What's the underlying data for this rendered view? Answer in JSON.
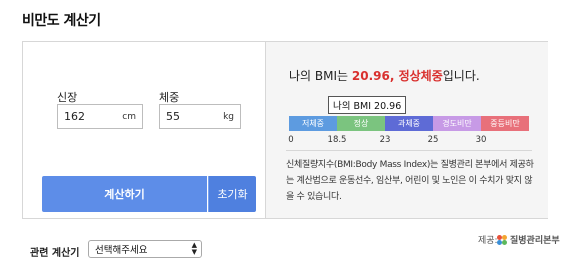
{
  "page": {
    "title": "비만도 계산기"
  },
  "inputs": {
    "height": {
      "label": "신장",
      "value": "162",
      "unit": "cm"
    },
    "weight": {
      "label": "체중",
      "value": "55",
      "unit": "kg"
    }
  },
  "buttons": {
    "calculate": "계산하기",
    "reset": "초기화"
  },
  "result": {
    "prefix": "나의 BMI는 ",
    "bmi": "20.96",
    "separator": ", ",
    "category": "정상체중",
    "suffix": "입니다.",
    "tooltip": "나의 BMI 20.96",
    "bmi_value": 20.96,
    "highlight_color": "#d9302e"
  },
  "scale": {
    "segments": [
      {
        "label": "저체중",
        "color": "#5d9be0"
      },
      {
        "label": "정상",
        "color": "#7bc47f"
      },
      {
        "label": "과체중",
        "color": "#5e6bd6"
      },
      {
        "label": "경도비만",
        "color": "#c79ae6"
      },
      {
        "label": "중등비만",
        "color": "#e8707a"
      }
    ],
    "ticks": [
      "0",
      "18.5",
      "23",
      "25",
      "30"
    ]
  },
  "description": "신체질량지수(BMI:Body Mass Index)는 질병관리 본부에서 제공하는 계산법으로 운동선수, 임산부, 어린이 및 노인은 이 수치가 맞지 않을 수 있습니다.",
  "provider": {
    "label": "제공:",
    "name": "질병관리본부"
  },
  "related": {
    "label": "관련 계산기",
    "selected": "선택해주세요"
  },
  "colors": {
    "primary_button": "#5d8de8",
    "reset_button": "#4f80df"
  }
}
